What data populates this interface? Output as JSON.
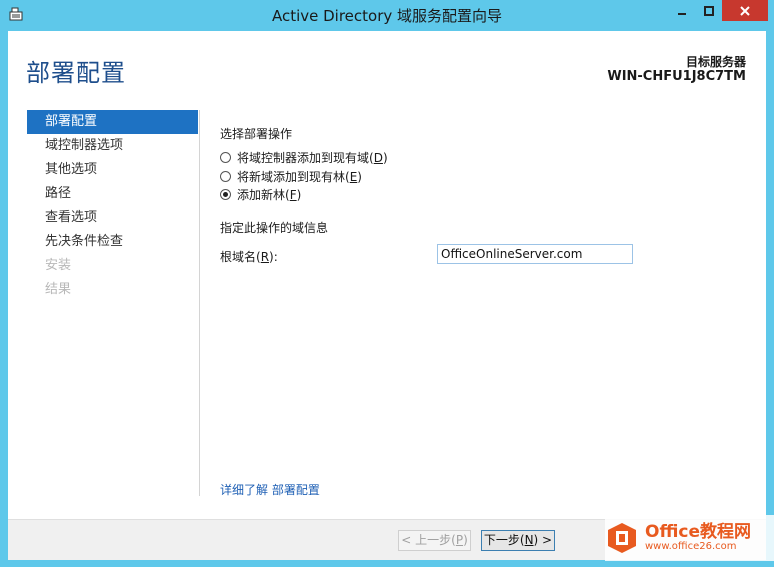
{
  "window": {
    "title": "Active Directory 域服务配置向导"
  },
  "header": {
    "page_title": "部署配置",
    "target_label": "目标服务器",
    "target_name": "WIN-CHFU1J8C7TM"
  },
  "nav": {
    "items": [
      {
        "label": "部署配置",
        "state": "active"
      },
      {
        "label": "域控制器选项",
        "state": "normal"
      },
      {
        "label": "其他选项",
        "state": "normal"
      },
      {
        "label": "路径",
        "state": "normal"
      },
      {
        "label": "查看选项",
        "state": "normal"
      },
      {
        "label": "先决条件检查",
        "state": "normal"
      },
      {
        "label": "安装",
        "state": "disabled"
      },
      {
        "label": "结果",
        "state": "disabled"
      }
    ]
  },
  "main": {
    "operation_label": "选择部署操作",
    "options": [
      {
        "text": "将域控制器添加到现有域(",
        "key": "D",
        "end": ")",
        "checked": false
      },
      {
        "text": "将新域添加到现有林(",
        "key": "E",
        "end": ")",
        "checked": false
      },
      {
        "text": "添加新林(",
        "key": "F",
        "end": ")",
        "checked": true
      }
    ],
    "domain_info_label": "指定此操作的域信息",
    "root_domain_label": "根域名(",
    "root_domain_key": "R",
    "root_domain_end": "):",
    "root_domain_value": "OfficeOnlineServer.com",
    "more_link": "详细了解 部署配置"
  },
  "buttons": {
    "back": {
      "text": "< 上一步(",
      "key": "P",
      "end": ")"
    },
    "next": {
      "text": "下一步(",
      "key": "N",
      "end": ") >"
    }
  },
  "watermark": {
    "title": "Office教程网",
    "url": "www.office26.com"
  },
  "colors": {
    "window_frame": "#5ec8ea",
    "accent": "#1e72c3",
    "title_text": "#1e4e8c",
    "link": "#1e5fb4",
    "close_button": "#c7382e"
  }
}
